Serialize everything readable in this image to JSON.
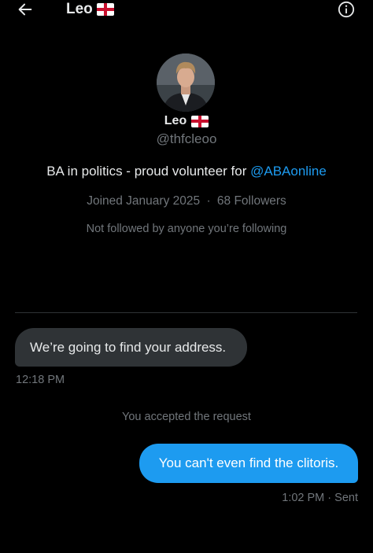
{
  "header": {
    "title": "Leo",
    "back_icon": "arrow-left-icon",
    "info_icon": "info-icon",
    "flag_icon": "england-flag-icon"
  },
  "profile": {
    "name": "Leo",
    "handle": "@thfcleoo",
    "bio_text": "BA in politics - proud volunteer for ",
    "bio_mention": "@ABAonline",
    "joined": "Joined January 2025",
    "separator": "·",
    "followers": "68 Followers",
    "not_followed": "Not followed by anyone you’re following",
    "avatar_icon": "profile-photo"
  },
  "messages": [
    {
      "direction": "incoming",
      "text": "We’re going to find your address.",
      "time": "12:18 PM"
    },
    {
      "direction": "system",
      "text": "You accepted the request"
    },
    {
      "direction": "outgoing",
      "text": "You can't even find the clitoris.",
      "time": "1:02 PM",
      "status": "Sent"
    }
  ],
  "colors": {
    "background": "#000000",
    "text_primary": "#e7e9ea",
    "text_secondary": "#71767b",
    "accent": "#1d9bf0",
    "bubble_incoming": "#2f3336",
    "divider": "#2f3336"
  }
}
